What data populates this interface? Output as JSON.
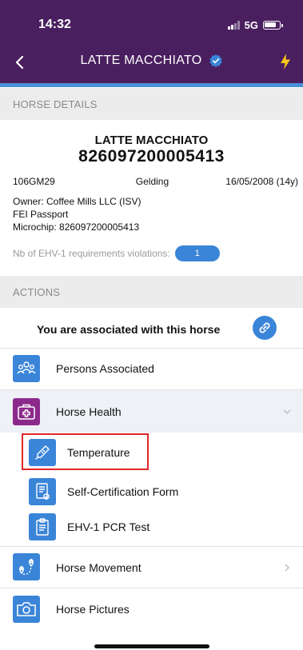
{
  "status_bar": {
    "time": "14:32",
    "network": "5G"
  },
  "nav": {
    "title": "LATTE MACCHIATO"
  },
  "sections": {
    "details": "HORSE DETAILS",
    "actions": "ACTIONS"
  },
  "horse": {
    "name": "LATTE MACCHIATO",
    "id_number": "826097200005413",
    "code": "106GM29",
    "sex": "Gelding",
    "dob": "16/05/2008 (14y)",
    "owner": "Owner:  Coffee Mills LLC (ISV)",
    "passport": "FEI Passport",
    "microchip": "Microchip:  826097200005413",
    "violations_label": "Nb of EHV-1 requirements violations:",
    "violations_count": "1"
  },
  "actions": {
    "associated_text": "You are associated with this horse",
    "items": [
      {
        "label": "Persons Associated",
        "icon": "people-icon"
      },
      {
        "label": "Horse Health",
        "icon": "medical-kit-icon"
      },
      {
        "label": "Temperature",
        "icon": "thermometer-icon"
      },
      {
        "label": "Self-Certification Form",
        "icon": "form-icon"
      },
      {
        "label": "EHV-1 PCR Test",
        "icon": "clipboard-icon"
      },
      {
        "label": "Horse Movement",
        "icon": "route-icon"
      },
      {
        "label": "Horse Pictures",
        "icon": "camera-icon"
      }
    ]
  },
  "colors": {
    "header": "#4a1f5f",
    "accent": "#4a90d9",
    "icon_blue": "#3a85d8",
    "icon_purple": "#8c2a8c",
    "highlight_red": "#e02727"
  }
}
